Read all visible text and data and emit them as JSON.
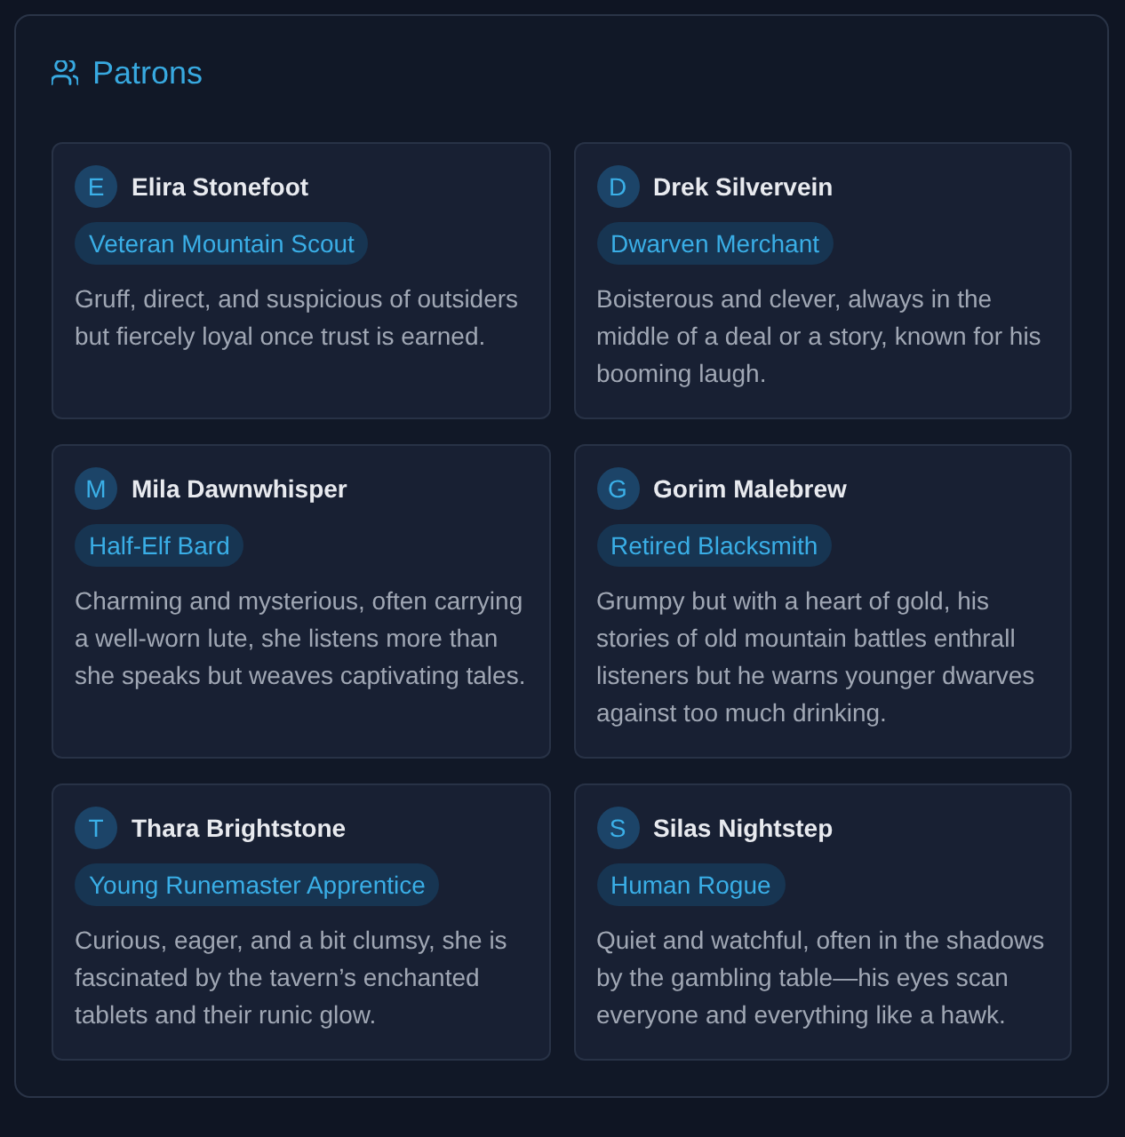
{
  "panel": {
    "title": "Patrons"
  },
  "patrons": [
    {
      "initial": "E",
      "name": "Elira Stonefoot",
      "role": "Veteran Mountain Scout",
      "description": "Gruff, direct, and suspicious of outsiders but fiercely loyal once trust is earned."
    },
    {
      "initial": "D",
      "name": "Drek Silvervein",
      "role": "Dwarven Merchant",
      "description": "Boisterous and clever, always in the middle of a deal or a story, known for his booming laugh."
    },
    {
      "initial": "M",
      "name": "Mila Dawnwhisper",
      "role": "Half-Elf Bard",
      "description": "Charming and mysterious, often carrying a well-worn lute, she listens more than she speaks but weaves captivating tales."
    },
    {
      "initial": "G",
      "name": "Gorim Malebrew",
      "role": "Retired Blacksmith",
      "description": "Grumpy but with a heart of gold, his stories of old mountain battles enthrall listeners but he warns younger dwarves against too much drinking."
    },
    {
      "initial": "T",
      "name": "Thara Brightstone",
      "role": "Young Runemaster Apprentice",
      "description": "Curious, eager, and a bit clumsy, she is fascinated by the tavern’s enchanted tablets and their runic glow."
    },
    {
      "initial": "S",
      "name": "Silas Nightstep",
      "role": "Human Rogue",
      "description": "Quiet and watchful, often in the shadows by the gambling table—his eyes scan everyone and everything like a hawk."
    }
  ]
}
